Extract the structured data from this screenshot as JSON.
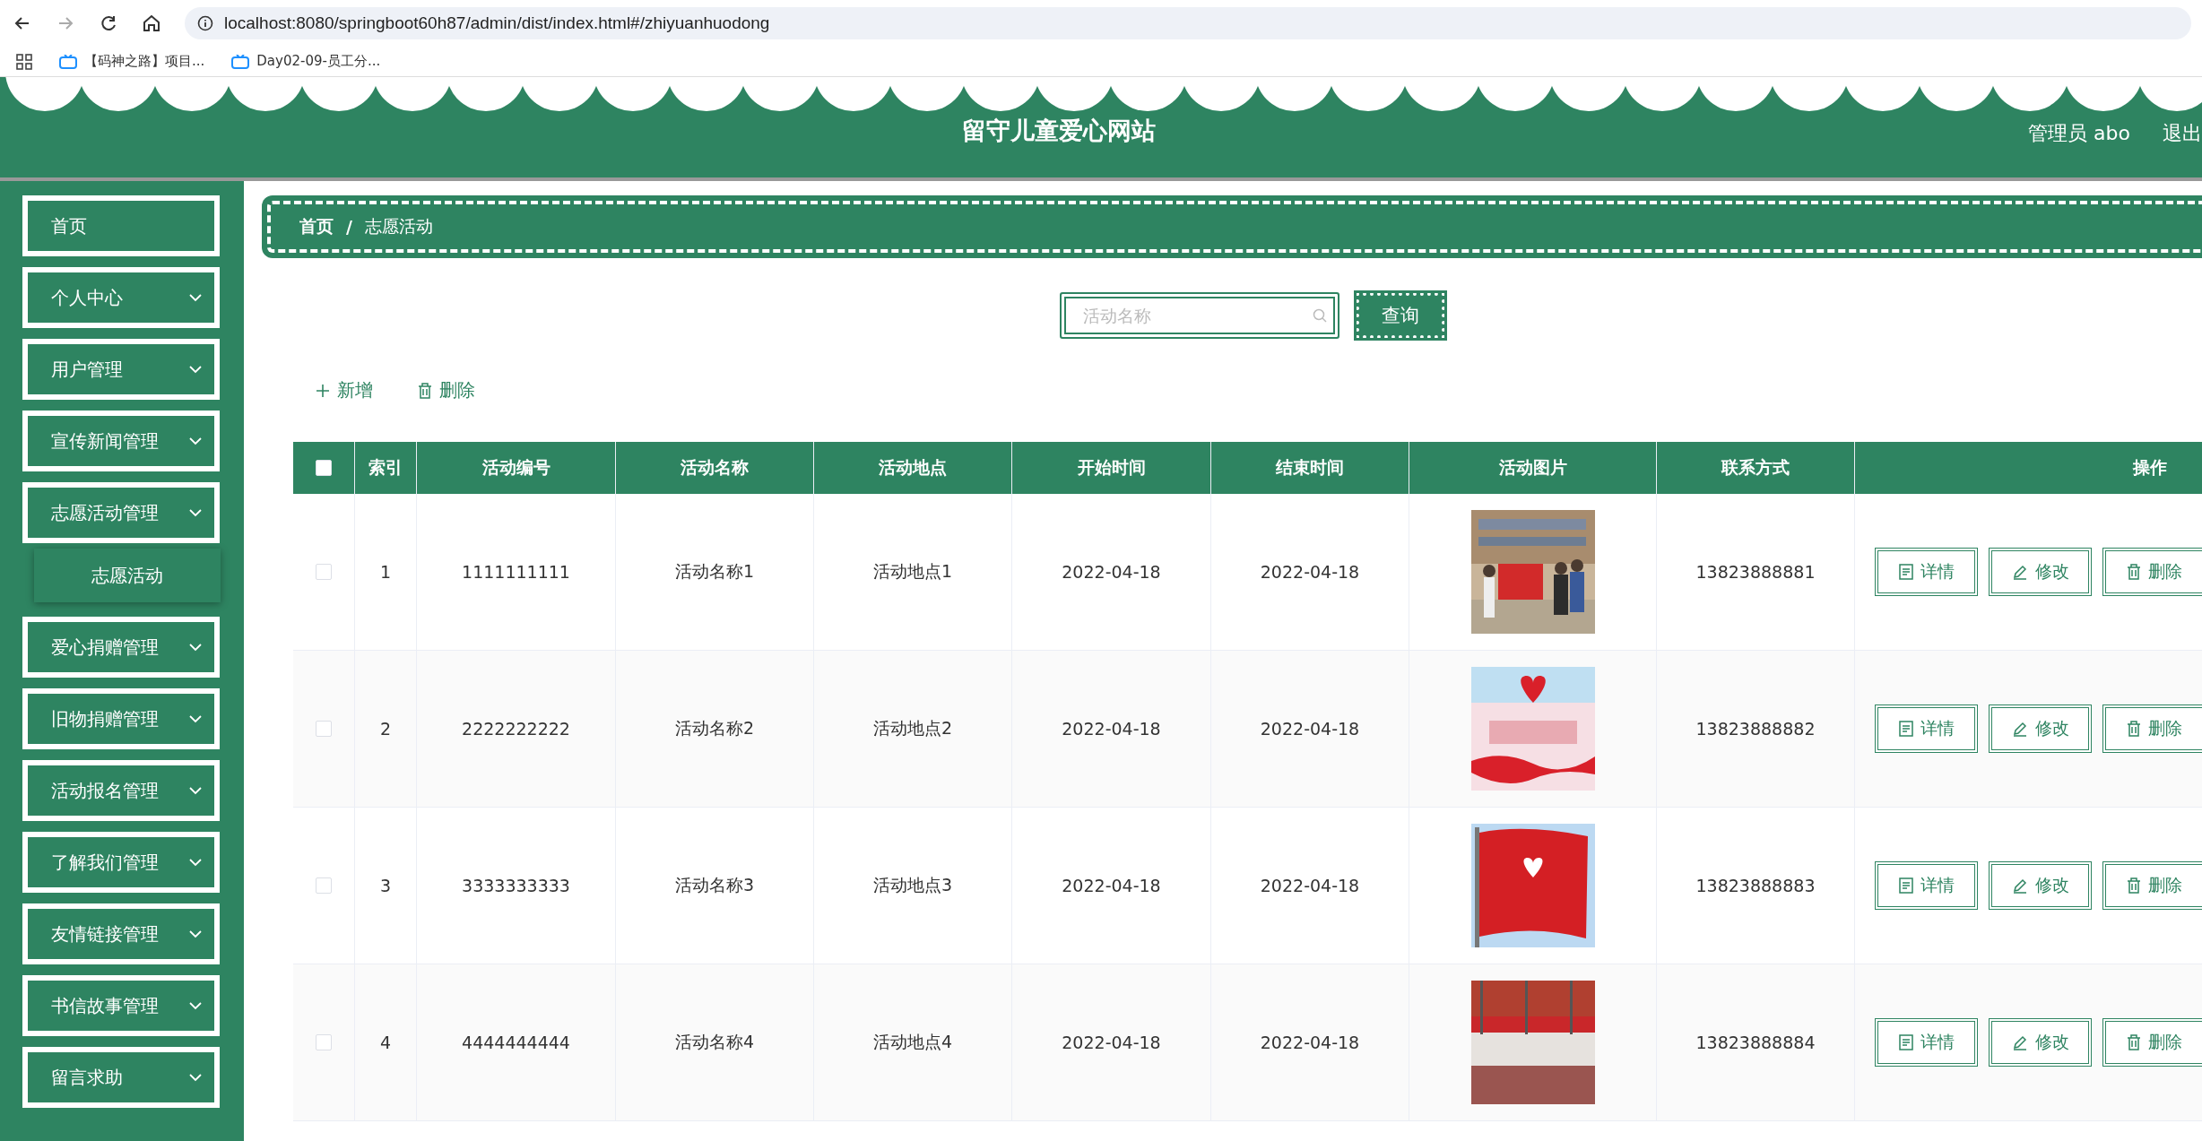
{
  "browser": {
    "url": "localhost:8080/springboot60h87/admin/dist/index.html#/zhiyuanhuodong",
    "bookmarks": [
      "【码神之路】项目...",
      "Day02-09-员工分..."
    ]
  },
  "header": {
    "title": "留守儿童爱心网站",
    "user": "管理员 abo",
    "logout": "退出"
  },
  "sidebar": {
    "items": [
      {
        "label": "首页",
        "kind": "link"
      },
      {
        "label": "个人中心",
        "kind": "menu"
      },
      {
        "label": "用户管理",
        "kind": "menu"
      },
      {
        "label": "宣传新闻管理",
        "kind": "menu"
      },
      {
        "label": "志愿活动管理",
        "kind": "menu",
        "children": [
          {
            "label": "志愿活动"
          }
        ]
      },
      {
        "label": "爱心捐赠管理",
        "kind": "menu"
      },
      {
        "label": "旧物捐赠管理",
        "kind": "menu"
      },
      {
        "label": "活动报名管理",
        "kind": "menu"
      },
      {
        "label": "了解我们管理",
        "kind": "menu"
      },
      {
        "label": "友情链接管理",
        "kind": "menu"
      },
      {
        "label": "书信故事管理",
        "kind": "menu"
      },
      {
        "label": "留言求助",
        "kind": "menu"
      }
    ]
  },
  "breadcrumb": {
    "separator": "/",
    "items": [
      "首页",
      "志愿活动"
    ]
  },
  "search": {
    "placeholder": "活动名称",
    "button": "查询"
  },
  "actions": [
    "新增",
    "删除"
  ],
  "table": {
    "all_checked": false,
    "columns": [
      "索引",
      "活动编号",
      "活动名称",
      "活动地点",
      "开始时间",
      "结束时间",
      "活动图片",
      "联系方式",
      "操作"
    ],
    "rows": [
      {
        "checked": false,
        "cells": [
          "1",
          "1111111111",
          "活动名称1",
          "活动地点1",
          "2022-04-18",
          "2022-04-18"
        ],
        "picture": {
          "kind": "picture"
        },
        "phone": "13823888881",
        "buttons": [
          "详情",
          "修改",
          "删除"
        ]
      },
      {
        "checked": false,
        "cells": [
          "2",
          "2222222222",
          "活动名称2",
          "活动地点2",
          "2022-04-18",
          "2022-04-18"
        ],
        "picture": {
          "kind": "picture"
        },
        "phone": "13823888882",
        "buttons": [
          "详情",
          "修改",
          "删除"
        ]
      },
      {
        "checked": false,
        "cells": [
          "3",
          "3333333333",
          "活动名称3",
          "活动地点3",
          "2022-04-18",
          "2022-04-18"
        ],
        "picture": {
          "kind": "picture"
        },
        "phone": "13823888883",
        "buttons": [
          "详情",
          "修改",
          "删除"
        ]
      },
      {
        "checked": false,
        "cells": [
          "4",
          "4444444444",
          "活动名称4",
          "活动地点4",
          "2022-04-18",
          "2022-04-18"
        ],
        "picture": {
          "kind": "picture"
        },
        "phone": "13823888884",
        "buttons": [
          "详情",
          "修改",
          "删除"
        ]
      }
    ]
  }
}
